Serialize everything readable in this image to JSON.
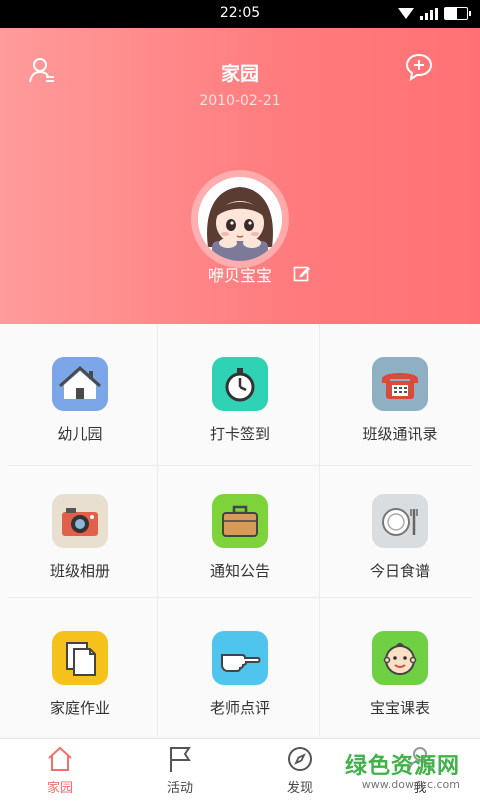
{
  "status_bar": {
    "time": "22:05"
  },
  "header": {
    "title": "家园",
    "date": "2010-02-21"
  },
  "profile": {
    "name": "咿贝宝宝"
  },
  "grid": [
    {
      "label": "幼儿园",
      "icon": "house-icon",
      "color": "#7ba6e8"
    },
    {
      "label": "打卡签到",
      "icon": "stopwatch-icon",
      "color": "#2fd2b4"
    },
    {
      "label": "班级通讯录",
      "icon": "telephone-icon",
      "color": "#8fb0c3"
    },
    {
      "label": "班级相册",
      "icon": "camera-icon",
      "color": "#e8dfd0"
    },
    {
      "label": "通知公告",
      "icon": "briefcase-icon",
      "color": "#7dd339"
    },
    {
      "label": "今日食谱",
      "icon": "plate-icon",
      "color": "#d9dde0"
    },
    {
      "label": "家庭作业",
      "icon": "documents-icon",
      "color": "#f5c21b"
    },
    {
      "label": "老师点评",
      "icon": "pointing-hand-icon",
      "color": "#4fc4ec"
    },
    {
      "label": "宝宝课表",
      "icon": "baby-face-icon",
      "color": "#6fd044"
    }
  ],
  "tabs": [
    {
      "label": "家园",
      "icon": "home-icon",
      "active": true
    },
    {
      "label": "活动",
      "icon": "flag-icon",
      "active": false
    },
    {
      "label": "发现",
      "icon": "compass-icon",
      "active": false
    },
    {
      "label": "我",
      "icon": "person-icon",
      "active": false
    }
  ],
  "watermark": {
    "line1": "绿色资源网",
    "line2": "www.downcc.com"
  },
  "colors": {
    "header_start": "#ff9b9b",
    "header_end": "#ff7174",
    "tab_active": "#f46e6e"
  }
}
